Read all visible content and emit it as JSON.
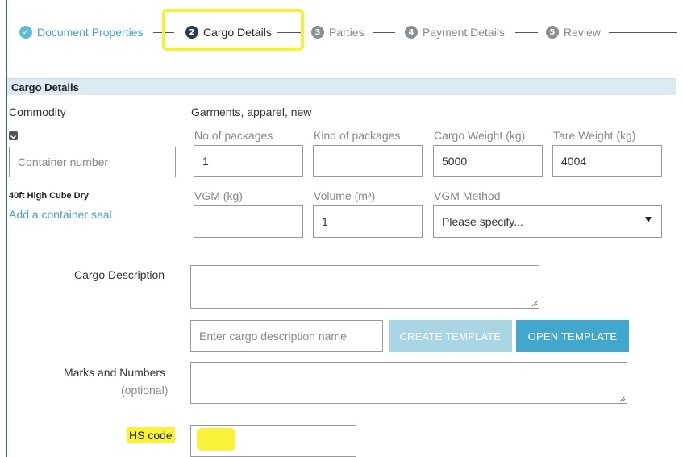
{
  "stepper": {
    "steps": [
      {
        "label": "Document Properties",
        "number": "✓",
        "state": "done"
      },
      {
        "label": "Cargo Details",
        "number": "2",
        "state": "active"
      },
      {
        "label": "Parties",
        "number": "3",
        "state": "future"
      },
      {
        "label": "Payment Details",
        "number": "4",
        "state": "future"
      },
      {
        "label": "Review",
        "number": "5",
        "state": "future"
      }
    ]
  },
  "section": {
    "title": "Cargo Details"
  },
  "commodity": {
    "label": "Commodity",
    "value": "Garments, apparel, new"
  },
  "container": {
    "toggle_icon": "chevron-down-square-icon",
    "number_placeholder": "Container number",
    "type": "40ft High Cube Dry",
    "add_seal_link": "Add a container seal"
  },
  "packages": {
    "label": "No.of packages",
    "value": "1"
  },
  "kind_of_packages": {
    "label": "Kind of packages",
    "value": ""
  },
  "cargo_weight": {
    "label": "Cargo Weight (kg)",
    "value": "5000"
  },
  "tare_weight": {
    "label": "Tare Weight (kg)",
    "value": "4004"
  },
  "vgm": {
    "label": "VGM (kg)",
    "value": ""
  },
  "volume": {
    "label": "Volume (m³)",
    "value": "1"
  },
  "vgm_method": {
    "label": "VGM Method",
    "selected": "Please specify..."
  },
  "cargo_description": {
    "label": "Cargo Description",
    "value": ""
  },
  "template": {
    "name_placeholder": "Enter cargo description name",
    "create_label": "CREATE TEMPLATE",
    "open_label": "OPEN TEMPLATE"
  },
  "marks": {
    "label": "Marks and Numbers",
    "optional": "(optional)",
    "value": ""
  },
  "hs_code": {
    "label": "HS code",
    "value": ""
  },
  "colors": {
    "accent": "#42a7cc",
    "done": "#5fbcd3",
    "highlight": "#f8f23a"
  }
}
